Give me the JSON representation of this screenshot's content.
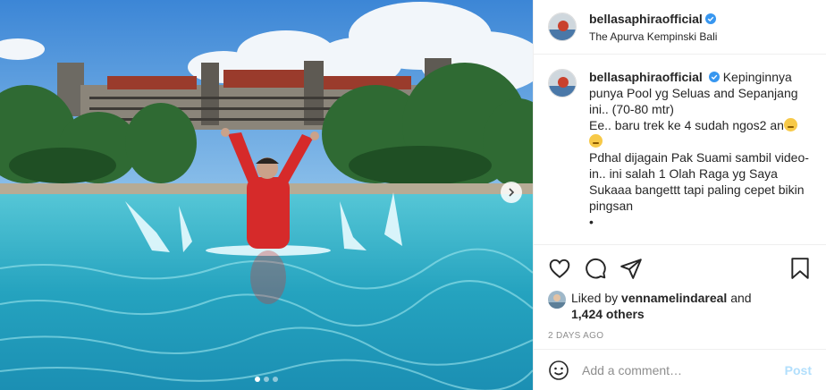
{
  "post": {
    "username": "bellasaphiraofficial",
    "location": "The Apurva Kempinski Bali",
    "caption_lines": [
      "Kepinginnya punya Pool yg Seluas and Sepanjang ini.. (70-80 mtr)",
      "Ee.. baru trek ke 4 sudah ngos2 an",
      "Pdhal dijagain Pak Suami sambil video-in.. ini salah 1 Olah Raga yg Saya Sukaaa bangettt tapi paling cepet bikin pingsan",
      "•"
    ],
    "liked_by_prefix": "Liked by",
    "liked_by_user": "vennamelindareal",
    "liked_by_and": "and",
    "likes_others": "1,424 others",
    "timestamp": "2 DAYS AGO"
  },
  "comment_box": {
    "placeholder": "Add a comment…",
    "post_label": "Post"
  },
  "carousel": {
    "total": 3,
    "active": 1
  },
  "colors": {
    "verified": "#3897f0",
    "post_disabled": "#b2dffc",
    "timestamp": "#8e8e8e"
  },
  "icons": {
    "like": "heart-icon",
    "comment": "comment-icon",
    "share": "paper-plane-icon",
    "save": "bookmark-icon",
    "emoji": "smiley-icon",
    "next": "chevron-right-icon"
  }
}
